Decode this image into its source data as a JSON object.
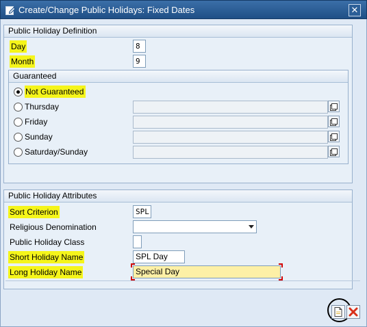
{
  "window": {
    "title": "Create/Change Public Holidays: Fixed Dates",
    "close_label": "✕"
  },
  "definition": {
    "header": "Public Holiday Definition",
    "day_label": "Day",
    "day_value": "8",
    "month_label": "Month",
    "month_value": "9"
  },
  "guaranteed": {
    "header": "Guaranteed",
    "options": [
      {
        "label": "Not Guaranteed",
        "selected": true
      },
      {
        "label": "Thursday",
        "selected": false
      },
      {
        "label": "Friday",
        "selected": false
      },
      {
        "label": "Sunday",
        "selected": false
      },
      {
        "label": "Saturday/Sunday",
        "selected": false
      }
    ]
  },
  "attributes": {
    "header": "Public Holiday Attributes",
    "sort_label": "Sort Criterion",
    "sort_value": "SPL",
    "religious_label": "Religious Denomination",
    "religious_value": "",
    "class_label": "Public Holiday Class",
    "class_value": "",
    "short_label": "Short Holiday Name",
    "short_value": "SPL Day",
    "long_label": "Long Holiday Name",
    "long_value": "Special Day"
  },
  "toolbar": {
    "create_icon": "new-document-icon",
    "cancel_icon": "cancel-x-icon"
  },
  "colors": {
    "highlight": "#f5f51b",
    "titlebar": "#2b5e97",
    "active_field": "#fdf0a6",
    "cancel": "#d9301a"
  }
}
